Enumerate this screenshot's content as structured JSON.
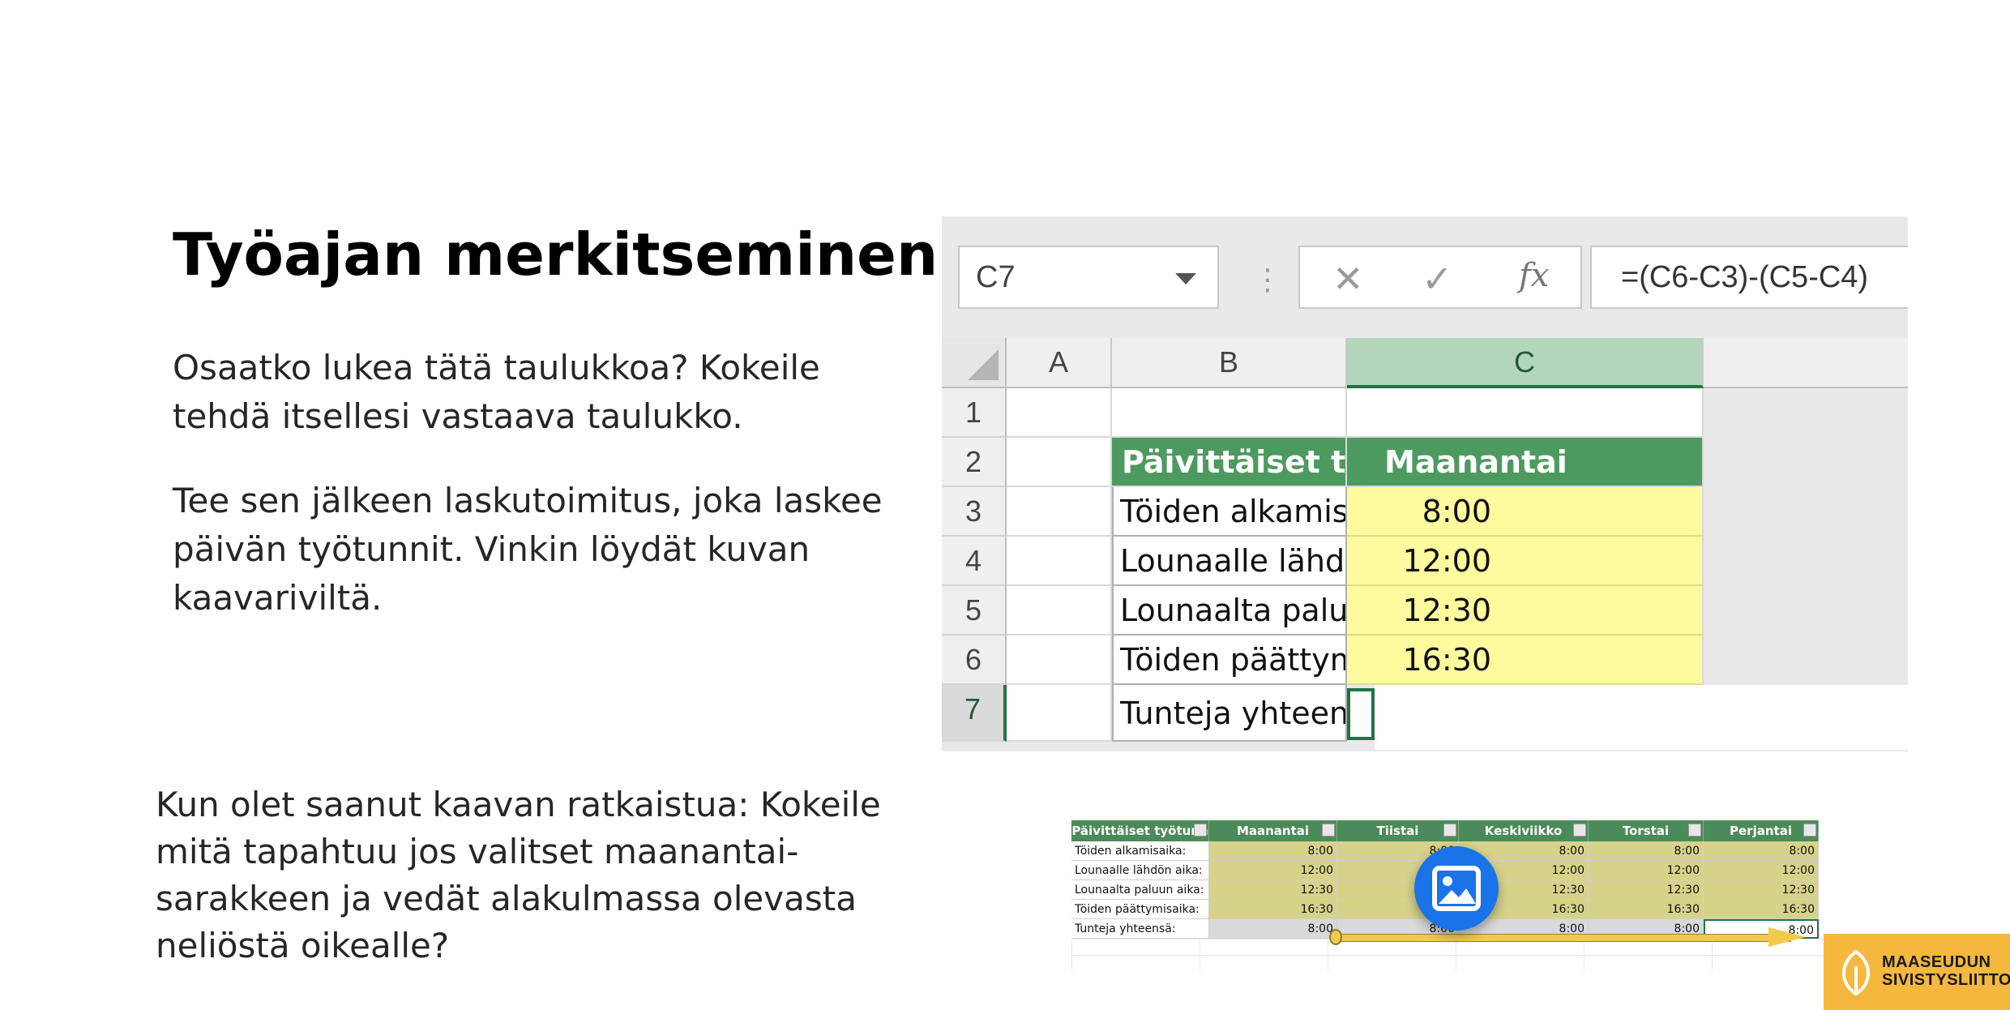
{
  "slide": {
    "title": "Työajan merkitseminen",
    "paragraph1": "Osaatko lukea tätä taulukkoa? Kokeile tehdä itsellesi vastaava taulukko.",
    "paragraph2": "Tee sen jälkeen laskutoimitus, joka laskee päivän työtunnit. Vinkin löydät kuvan kaavariviltä.",
    "paragraph3": "Kun olet saanut kaavan ratkaistua: Kokeile mitä tapahtuu jos valitset maanantai-sarakkeen ja vedät alakulmassa olevasta neliöstä oikealle?"
  },
  "excel": {
    "name_box": "C7",
    "formula": "=(C6-C3)-(C5-C4)",
    "columns": [
      "A",
      "B",
      "C"
    ],
    "rows": [
      "1",
      "2",
      "3",
      "4",
      "5",
      "6",
      "7"
    ],
    "header_label": "Päivittäiset työtunnit",
    "header_day": "Maanantai",
    "labels": [
      "Töiden alkamisaika:",
      "Lounaalle lähdön aika:",
      "Lounaalta paluun aika:",
      "Töiden päättymisaika:",
      "Tunteja yhteensä:"
    ],
    "values": [
      "8:00",
      "12:00",
      "12:30",
      "16:30"
    ]
  },
  "thumbnail": {
    "headers": [
      "Päivittäiset työtunn",
      "Maanantai",
      "Tiistai",
      "Keskiviikko",
      "Torstai",
      "Perjantai"
    ],
    "rows": [
      {
        "label": "Töiden alkamisaika:",
        "values": [
          "8:00",
          "8:00",
          "8:00",
          "8:00",
          "8:00"
        ]
      },
      {
        "label": "Lounaalle lähdön aika:",
        "values": [
          "12:00",
          "12:00",
          "12:00",
          "12:00",
          "12:00"
        ]
      },
      {
        "label": "Lounaalta paluun aika:",
        "values": [
          "12:30",
          "12:30",
          "12:30",
          "12:30",
          "12:30"
        ]
      },
      {
        "label": "Töiden päättymisaika:",
        "values": [
          "16:30",
          "16:30",
          "16:30",
          "16:30",
          "16:30"
        ]
      },
      {
        "label": "Tunteja yhteensä:",
        "values": [
          "8:00",
          "8:00",
          "8:00",
          "8:00",
          "8:00"
        ]
      }
    ]
  },
  "logo": {
    "line1": "MAASEUDUN",
    "line2": "SIVISTYSLIITTO",
    "color": "#f4b83f"
  },
  "icons": {
    "image_badge": "image-icon",
    "logo_mark": "leaf-icon"
  }
}
